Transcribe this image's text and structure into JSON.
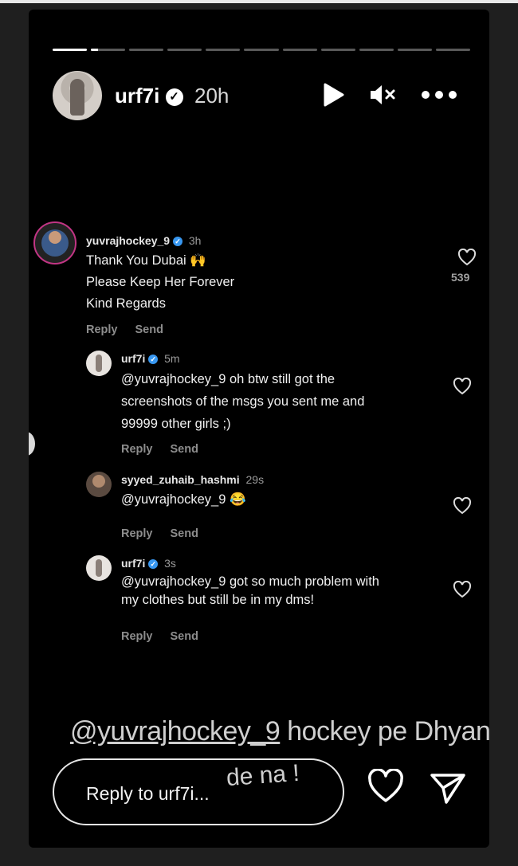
{
  "story": {
    "username": "urf7i",
    "time": "20h",
    "progress_segments": 11,
    "progress_active_index": 1,
    "progress_active_fraction": 0.2
  },
  "icons": {
    "play": "play-icon",
    "mute": "muted-speaker-icon",
    "more": "more-horizontal-icon",
    "heart": "heart-outline-icon",
    "send": "paper-plane-icon",
    "verified": "verified-badge-icon"
  },
  "comments": [
    {
      "user": "yuvrajhockey_9",
      "time": "3h",
      "text": "Thank You Dubai 🙌\nPlease Keep Her Forever\nKind Regards",
      "likes": "539",
      "reply": "Reply",
      "send": "Send"
    },
    {
      "user": "urf7i",
      "time": "5m",
      "text": "@yuvrajhockey_9 oh btw still got the\nscreenshots of the msgs you sent me and\n99999 other girls ;)",
      "reply": "Reply",
      "send": "Send"
    },
    {
      "user": "syyed_zuhaib_hashmi",
      "time": "29s",
      "text": "@yuvrajhockey_9 😂",
      "reply": "Reply",
      "send": "Send"
    },
    {
      "user": "urf7i",
      "time": "3s",
      "text": "@yuvrajhockey_9 got so much problem with\nmy clothes but still be in my dms!",
      "reply": "Reply",
      "send": "Send"
    }
  ],
  "caption": {
    "mention": "@yuvrajhockey_9",
    "line1_rest": " hockey pe Dhyan",
    "line2": "de na !"
  },
  "reply_box": {
    "placeholder": "Reply to urf7i..."
  },
  "colors": {
    "background": "#000000",
    "verified_blue": "#3897f0",
    "text_muted": "#8d8d8d"
  }
}
